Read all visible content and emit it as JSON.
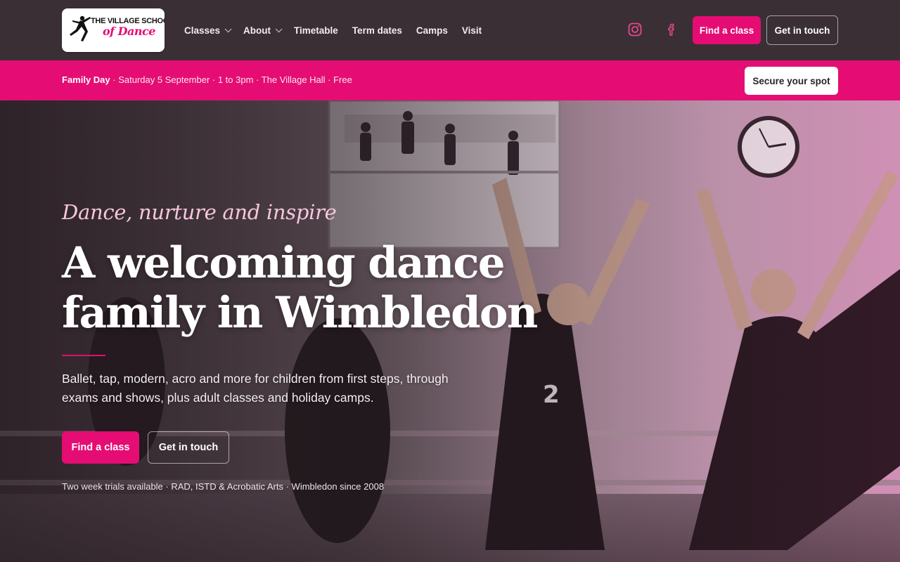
{
  "logo": {
    "line1": "THE VILLAGE SCHOOL",
    "line2": "of Dance"
  },
  "nav": {
    "items": [
      {
        "label": "Classes",
        "has_dropdown": true
      },
      {
        "label": "About",
        "has_dropdown": true
      },
      {
        "label": "Timetable",
        "has_dropdown": false
      },
      {
        "label": "Term dates",
        "has_dropdown": false
      },
      {
        "label": "Camps",
        "has_dropdown": false
      },
      {
        "label": "Visit",
        "has_dropdown": false
      }
    ],
    "social": [
      {
        "icon": "instagram-icon"
      },
      {
        "icon": "facebook-icon"
      }
    ],
    "find_class": "Find a class",
    "get_in_touch": "Get in touch"
  },
  "banner": {
    "event": "Family Day",
    "details": " · Saturday 5 September · 1 to 3pm · The Village Hall · Free",
    "cta": "Secure your spot"
  },
  "hero": {
    "eyebrow": "Dance, nurture and inspire",
    "headline": "A welcoming dance family in Wimbledon",
    "lede": "Ballet, tap, modern, acro and more for children from first steps, through exams and shows, plus adult classes and holiday camps.",
    "primary_cta": "Find a class",
    "secondary_cta": "Get in touch",
    "meta": "Two week trials available · RAD, ISTD & Acrobatic Arts · Wimbledon since 2008"
  },
  "colors": {
    "accent": "#e50d73",
    "header_bg": "#3a2f35",
    "text_light": "#ffffff"
  }
}
